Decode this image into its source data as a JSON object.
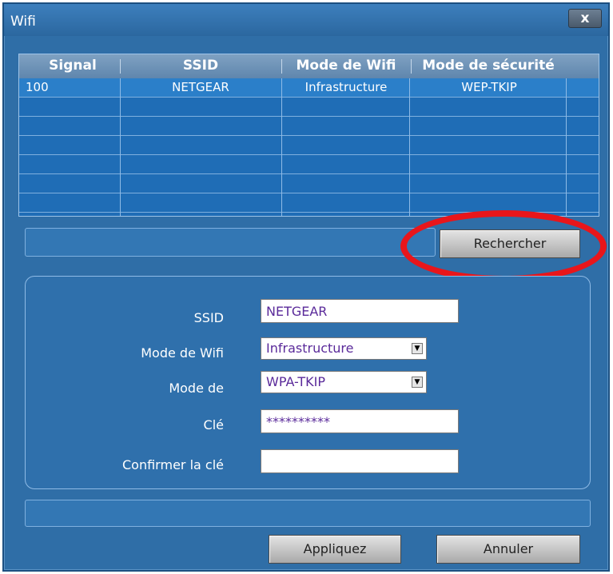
{
  "window": {
    "title": "Wifi",
    "close_label": "x"
  },
  "table": {
    "headers": [
      "Signal",
      "SSID",
      "Mode de Wifi",
      "Mode de sécurité"
    ],
    "rows": [
      {
        "signal": "100",
        "ssid": "NETGEAR",
        "wifi_mode": "Infrastructure",
        "security_mode": "WEP-TKIP"
      }
    ]
  },
  "search_button": "Rechercher",
  "form": {
    "ssid_label": "SSID",
    "ssid_value": "NETGEAR",
    "wifi_mode_label": "Mode de Wifi",
    "wifi_mode_value": "Infrastructure",
    "security_label": "Mode de",
    "security_value": "WPA-TKIP",
    "key_label": "Clé",
    "key_value": "**********",
    "confirm_label": "Confirmer la clé",
    "confirm_value": ""
  },
  "buttons": {
    "apply": "Appliquez",
    "cancel": "Annuler"
  },
  "colors": {
    "panel": "#2f6ea7",
    "highlight_ring": "#e8161b",
    "input_text": "#5a2a9a"
  }
}
